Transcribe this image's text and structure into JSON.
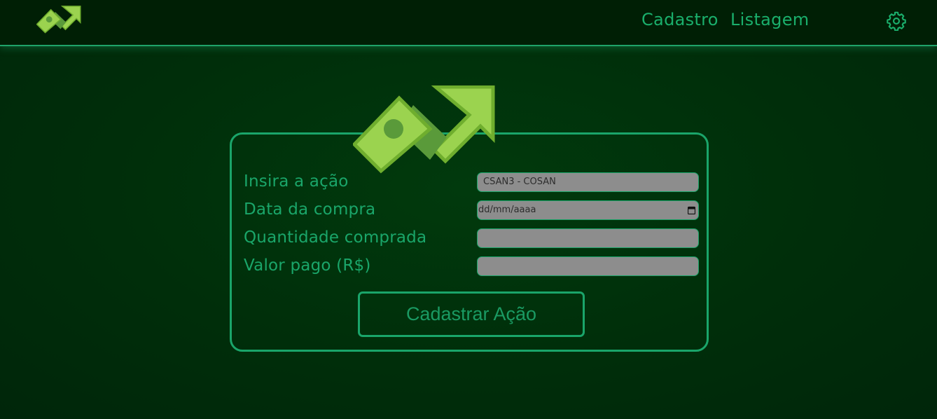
{
  "header": {
    "logo_icon": "money-up-arrow-logo",
    "nav": [
      {
        "label": "Cadastro"
      },
      {
        "label": "Listagem"
      }
    ],
    "settings_icon": "gear-icon"
  },
  "form": {
    "logo_icon": "money-up-arrow-logo",
    "fields": [
      {
        "label": "Insira a ação",
        "value": "CSAN3 - COSAN"
      },
      {
        "label": "Data da compra",
        "value": "dd/mm/aaaa"
      },
      {
        "label": "Quantidade comprada",
        "value": ""
      },
      {
        "label": "Valor pago (R$)",
        "value": ""
      }
    ],
    "submit_label": "Cadastrar Ação"
  },
  "colors": {
    "accent": "#1aa56a",
    "background": "#002e0a",
    "topbar": "#001f05",
    "field_bg": "#8d8d8d",
    "logo_green": "#9bd34f"
  }
}
